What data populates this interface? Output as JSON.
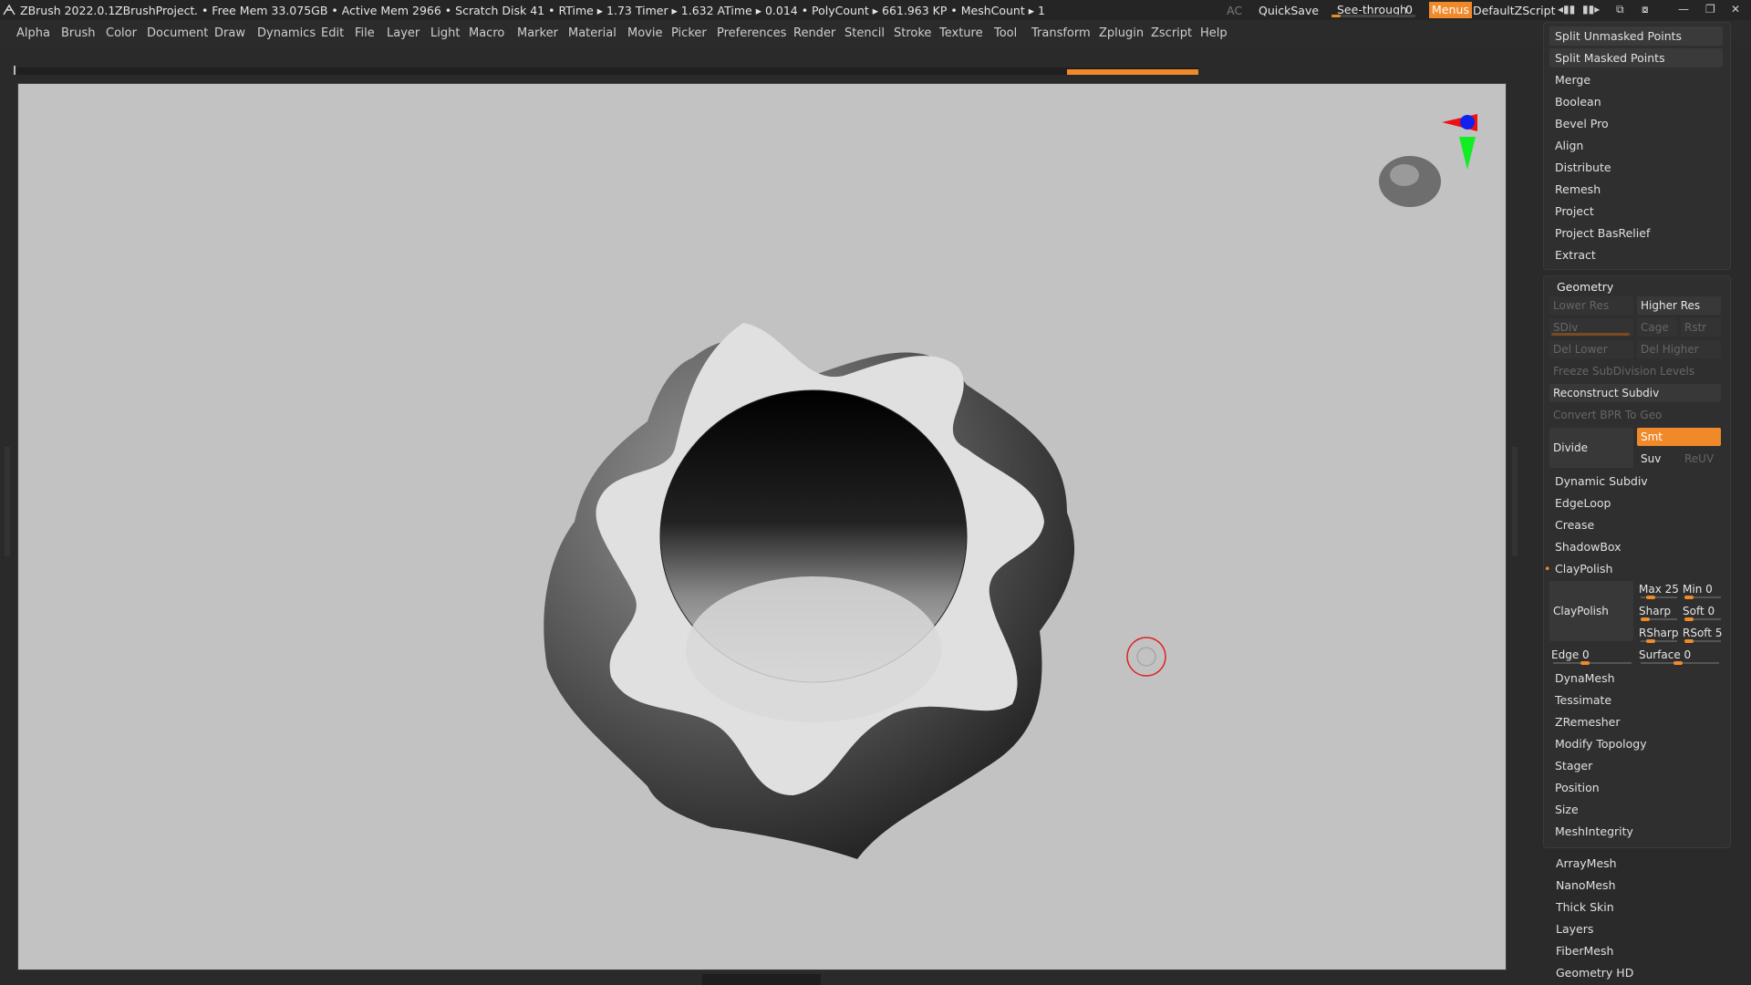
{
  "titlebar": {
    "app": "ZBrush 2022.0.1",
    "project": "ZBrushProject",
    "stats": ". • Free Mem 33.075GB • Active Mem 2966 • Scratch Disk 41 • RTime ▸ 1.73 Timer ▸ 1.632 ATime ▸ 0.014 • PolyCount ▸ 661.963 KP • MeshCount ▸ 1",
    "ac": "AC",
    "quicksave": "QuickSave",
    "seethrough_label": "See-through",
    "seethrough_value": "0",
    "seethrough_level": 0.0,
    "menus": "Menus",
    "script": "DefaultZScript"
  },
  "menubar": [
    "Alpha",
    "Brush",
    "Color",
    "Document",
    "Draw",
    "Dynamics",
    "Edit",
    "File",
    "Layer",
    "Light",
    "Macro",
    "Marker",
    "Material",
    "Movie",
    "Picker",
    "Preferences",
    "Render",
    "Stencil",
    "Stroke",
    "Texture",
    "Tool",
    "Transform",
    "Zplugin",
    "Zscript",
    "Help"
  ],
  "subtool_panel": {
    "items": [
      {
        "label": "Split Unmasked Points",
        "boxed": true
      },
      {
        "label": "Split Masked Points",
        "boxed": true
      },
      {
        "label": "Merge",
        "boxed": false
      },
      {
        "label": "Boolean",
        "boxed": false
      },
      {
        "label": "Bevel Pro",
        "boxed": false
      },
      {
        "label": "Align",
        "boxed": false
      },
      {
        "label": "Distribute",
        "boxed": false
      },
      {
        "label": "Remesh",
        "boxed": false
      },
      {
        "label": "Project",
        "boxed": false
      },
      {
        "label": "Project BasRelief",
        "boxed": false
      },
      {
        "label": "Extract",
        "boxed": false
      }
    ]
  },
  "geometry": {
    "title": "Geometry",
    "lower_res": "Lower Res",
    "higher_res": "Higher Res",
    "sdiv": "SDiv",
    "cage": "Cage",
    "rstr": "Rstr",
    "del_lower": "Del Lower",
    "del_higher": "Del Higher",
    "freeze": "Freeze SubDivision Levels",
    "reconstruct": "Reconstruct Subdiv",
    "convert_bpr": "Convert BPR To Geo",
    "divide": "Divide",
    "smt": "Smt",
    "suv": "Suv",
    "reuv": "ReUV",
    "dynamic_subdiv": "Dynamic Subdiv",
    "edgeloop": "EdgeLoop",
    "crease": "Crease",
    "shadowbox": "ShadowBox",
    "claypolish_header": "ClayPolish",
    "claypolish_button": "ClayPolish",
    "claypolish_sliders": {
      "max": {
        "label": "Max",
        "value": "25"
      },
      "min": {
        "label": "Min",
        "value": "0"
      },
      "sharp": {
        "label": "Sharp",
        "value": ""
      },
      "soft": {
        "label": "Soft",
        "value": "0"
      },
      "rsharp": {
        "label": "RSharp",
        "value": ""
      },
      "rsoft": {
        "label": "RSoft",
        "value": "5"
      },
      "edge": {
        "label": "Edge",
        "value": "0"
      },
      "surface": {
        "label": "Surface",
        "value": "0"
      }
    },
    "after": [
      "DynaMesh",
      "Tessimate",
      "ZRemesher",
      "Modify Topology",
      "Stager",
      "Position",
      "Size",
      "MeshIntegrity"
    ]
  },
  "subpanels": [
    "ArrayMesh",
    "NanoMesh",
    "Thick Skin",
    "Layers",
    "FiberMesh",
    "Geometry HD"
  ],
  "colors": {
    "accent": "#f0892a",
    "canvas_bg": "#c2c2c2",
    "panel_bg": "#2f2f2f"
  }
}
